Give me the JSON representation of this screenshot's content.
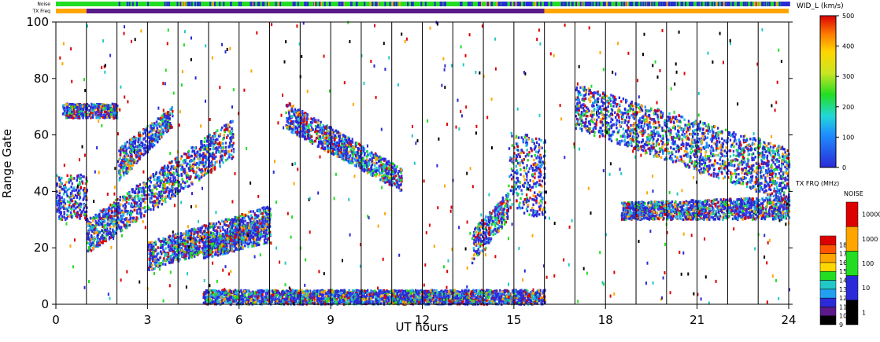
{
  "chart_data": {
    "type": "heatmap",
    "xlabel": "UT hours",
    "ylabel": "Range Gate",
    "xlim": [
      0,
      24
    ],
    "ylim": [
      0,
      100
    ],
    "xticks": [
      0,
      3,
      6,
      9,
      12,
      15,
      18,
      21,
      24
    ],
    "yticks": [
      0,
      20,
      40,
      60,
      80,
      100
    ],
    "vertical_hour_lines": [
      1,
      2,
      3,
      4,
      5,
      6,
      7,
      8,
      9,
      10,
      11,
      12,
      13,
      14,
      15,
      16,
      17,
      18,
      19,
      20,
      21,
      22,
      23
    ],
    "top_bars": {
      "noise_label": "Noise",
      "txfreq_label": "TX Freq",
      "txfreq_segments": [
        {
          "start": 0,
          "end": 1,
          "color": "#ffa500"
        },
        {
          "start": 1,
          "end": 16,
          "color": "#5a1a8a"
        },
        {
          "start": 16,
          "end": 24,
          "color": "#ffa500"
        }
      ]
    },
    "colorbars": {
      "width": {
        "title": "WID_L (km/s)",
        "ticks": [
          "0",
          "100",
          "200",
          "300",
          "400",
          "500"
        ]
      },
      "txfreq": {
        "title": "TX FRQ (MHz)",
        "ticks": [
          "9",
          "10",
          "11",
          "12",
          "13",
          "14",
          "15",
          "16",
          "17",
          "18"
        ],
        "colors": [
          "#000000",
          "#5a1a8a",
          "#2a2ad8",
          "#22a0f0",
          "#22c8c8",
          "#22dd22",
          "#ffd700",
          "#ffa500",
          "#ff5500",
          "#dd0000"
        ]
      },
      "noise": {
        "title": "NOISE",
        "ticks": [
          "1",
          "10",
          "100",
          "1000",
          "10000"
        ],
        "colors": [
          "#000000",
          "#2a2ad8",
          "#22dd22",
          "#ffa500",
          "#dd0000"
        ]
      }
    },
    "scatter_regions": [
      {
        "name": "dawn band 1",
        "x": [
          0.0,
          1.0
        ],
        "y_start": [
          30,
          46
        ],
        "y_end": [
          30,
          46
        ]
      },
      {
        "name": "ascending band A",
        "x": [
          1.0,
          5.8
        ],
        "y_start": [
          18,
          30
        ],
        "y_end": [
          52,
          66
        ]
      },
      {
        "name": "ascending band B",
        "x": [
          2.0,
          3.8
        ],
        "y_start": [
          43,
          55
        ],
        "y_end": [
          63,
          70
        ]
      },
      {
        "name": "upper band",
        "x": [
          0.2,
          2.0
        ],
        "y_start": [
          66,
          71
        ],
        "y_end": [
          66,
          71
        ]
      },
      {
        "name": "lower patch",
        "x": [
          3.0,
          7.0
        ],
        "y_start": [
          12,
          22
        ],
        "y_end": [
          25,
          35
        ]
      },
      {
        "name": "mid patch",
        "x": [
          4.8,
          7.0
        ],
        "y_start": [
          16,
          22
        ],
        "y_end": [
          22,
          32
        ]
      },
      {
        "name": "diagonal sparse",
        "x": [
          7.5,
          11.3
        ],
        "y_start": [
          62,
          72
        ],
        "y_end": [
          40,
          48
        ]
      },
      {
        "name": "gate 0-5 band",
        "x": [
          4.8,
          16.0
        ],
        "y_start": [
          0,
          5
        ],
        "y_end": [
          0,
          5
        ]
      },
      {
        "name": "pre-noon wedge",
        "x": [
          13.6,
          14.8
        ],
        "y_start": [
          14,
          26
        ],
        "y_end": [
          30,
          40
        ]
      },
      {
        "name": "noon cluster",
        "x": [
          14.8,
          16.0
        ],
        "y_start": [
          34,
          62
        ],
        "y_end": [
          30,
          58
        ]
      },
      {
        "name": "afternoon main",
        "x": [
          17.0,
          24.0
        ],
        "y_start": [
          62,
          78
        ],
        "y_end": [
          36,
          55
        ]
      },
      {
        "name": "afternoon low",
        "x": [
          18.5,
          24.0
        ],
        "y_start": [
          30,
          36
        ],
        "y_end": [
          30,
          38
        ]
      }
    ]
  }
}
